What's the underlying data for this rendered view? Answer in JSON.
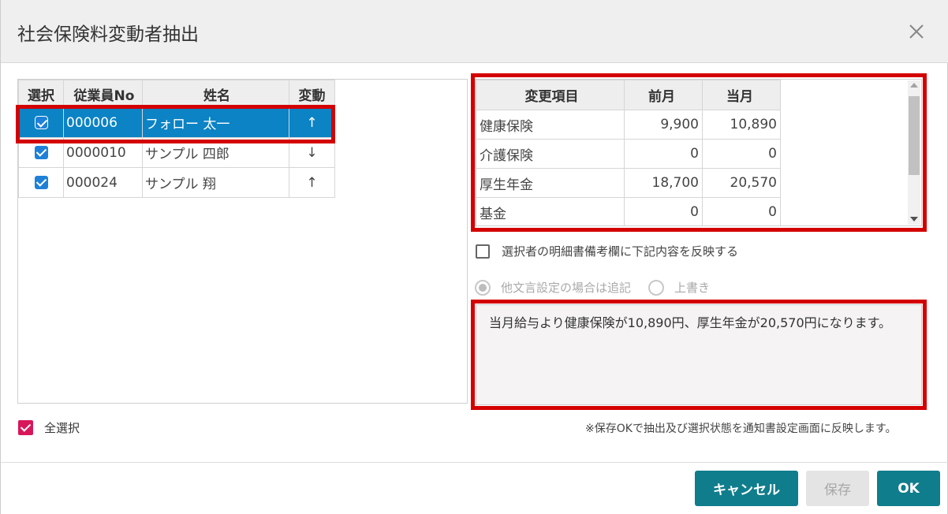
{
  "dialog": {
    "title": "社会保険料変動者抽出",
    "close_icon": "close-icon"
  },
  "employees": {
    "headers": [
      "選択",
      "従業員No",
      "姓名",
      "変動"
    ],
    "rows": [
      {
        "checked": true,
        "no": "000006",
        "name": "フォロー 太一",
        "change": "↑",
        "selected": true
      },
      {
        "checked": true,
        "no": "0000010",
        "name": "サンプル 四郎",
        "change": "↓",
        "selected": false
      },
      {
        "checked": true,
        "no": "000024",
        "name": "サンプル 翔",
        "change": "↑",
        "selected": false
      }
    ]
  },
  "select_all": {
    "label": "全選択",
    "checked": true
  },
  "changes": {
    "headers": [
      "変更項目",
      "前月",
      "当月"
    ],
    "rows": [
      {
        "item": "健康保険",
        "prev": "9,900",
        "curr": "10,890"
      },
      {
        "item": "介護保険",
        "prev": "0",
        "curr": "0"
      },
      {
        "item": "厚生年金",
        "prev": "18,700",
        "curr": "20,570"
      },
      {
        "item": "基金",
        "prev": "0",
        "curr": "0"
      }
    ]
  },
  "reflect_option": {
    "label": "選択者の明細書備考欄に下記内容を反映する",
    "checked": false
  },
  "radio_options": [
    {
      "label": "他文言設定の場合は追記",
      "selected": true
    },
    {
      "label": "上書き",
      "selected": false
    }
  ],
  "message": "当月給与より健康保険が10,890円、厚生年金が20,570円になります。",
  "note": "※保存OKで抽出及び選択状態を通知書設定画面に反映します。",
  "buttons": {
    "cancel": "キャンセル",
    "save": "保存",
    "ok": "OK"
  },
  "colors": {
    "accent": "#0f7d8c",
    "selected_row": "#0b83c5",
    "highlight": "#d40000",
    "select_all_check": "#d8175b"
  }
}
